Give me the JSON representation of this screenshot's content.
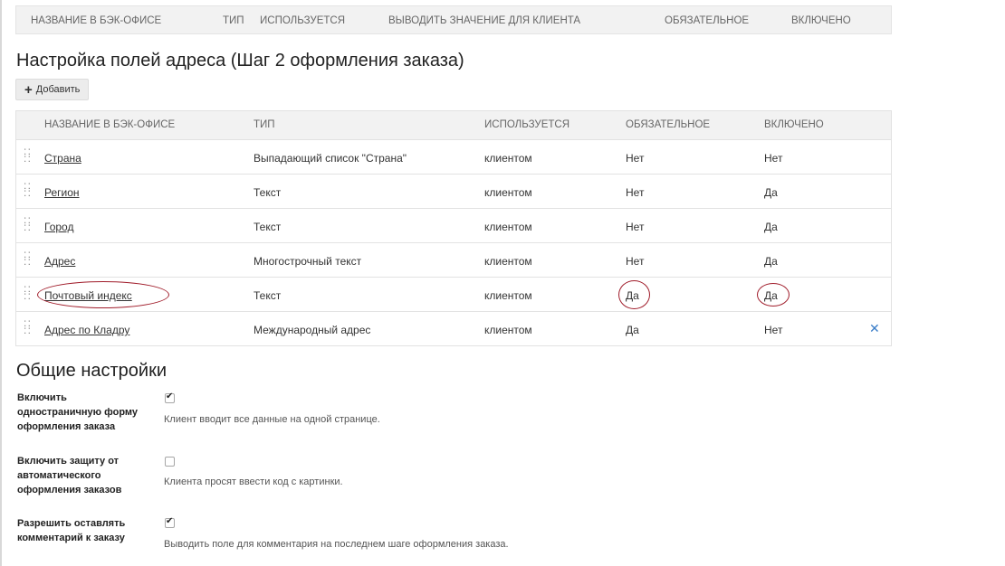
{
  "top_header": {
    "columns": [
      "НАЗВАНИЕ В БЭК-ОФИСЕ",
      "ТИП",
      "ИСПОЛЬЗУЕТСЯ",
      "ВЫВОДИТЬ ЗНАЧЕНИЕ ДЛЯ КЛИЕНТА",
      "ОБЯЗАТЕЛЬНОЕ",
      "ВКЛЮЧЕНО"
    ]
  },
  "address_section": {
    "title": "Настройка полей адреса (Шаг 2 оформления заказа)",
    "add_button": "Добавить",
    "columns": {
      "name": "НАЗВАНИЕ В БЭК-ОФИСЕ",
      "type": "ТИП",
      "used": "ИСПОЛЬЗУЕТСЯ",
      "required": "ОБЯЗАТЕЛЬНОЕ",
      "enabled": "ВКЛЮЧЕНО"
    },
    "rows": [
      {
        "name": "Страна",
        "type": "Выпадающий список \"Страна\"",
        "used": "клиентом",
        "required": "Нет",
        "enabled": "Нет"
      },
      {
        "name": "Регион",
        "type": "Текст",
        "used": "клиентом",
        "required": "Нет",
        "enabled": "Да"
      },
      {
        "name": "Город",
        "type": "Текст",
        "used": "клиентом",
        "required": "Нет",
        "enabled": "Да"
      },
      {
        "name": "Адрес",
        "type": "Многострочный текст",
        "used": "клиентом",
        "required": "Нет",
        "enabled": "Да"
      },
      {
        "name": "Почтовый индекс",
        "type": "Текст",
        "used": "клиентом",
        "required": "Да",
        "enabled": "Да"
      },
      {
        "name": "Адрес по Кладру",
        "type": "Международный адрес",
        "used": "клиентом",
        "required": "Да",
        "enabled": "Нет"
      }
    ]
  },
  "general_section": {
    "title": "Общие настройки",
    "settings": [
      {
        "label": "Включить одностраничную форму оформления заказа",
        "checked": true,
        "description": "Клиент вводит все данные на одной странице."
      },
      {
        "label": "Включить защиту от автоматического оформления заказов",
        "checked": false,
        "description": "Клиента просят ввести код с картинки."
      },
      {
        "label": "Разрешить оставлять комментарий к заказу",
        "checked": true,
        "description": "Выводить поле для комментария на последнем шаге оформления заказа."
      }
    ]
  },
  "colors": {
    "link": "#2a6ebb",
    "highlight": "#a01c2a",
    "delete_icon": "#3a7dc8"
  }
}
